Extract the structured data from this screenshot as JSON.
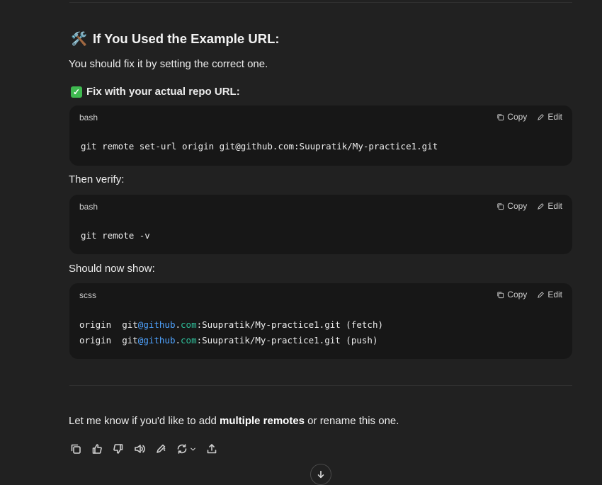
{
  "section": {
    "heading_icon": "🛠️",
    "heading": "If You Used the Example URL:",
    "intro": "You should fix it by setting the correct one.",
    "fix_label": "Fix with your actual repo URL:"
  },
  "blocks": [
    {
      "lang": "bash",
      "lines": [
        "git remote set-url origin git@github.com:Suupratik/My-practice1.git"
      ]
    },
    {
      "lang": "bash",
      "lines": [
        "git remote -v"
      ]
    },
    {
      "lang": "scss"
    }
  ],
  "scss_lines": [
    {
      "a": "origin  git",
      "b": "@github",
      "c": ".",
      "d": "com",
      "e": ":Suupratik/My-practice1.git (fetch)"
    },
    {
      "a": "origin  git",
      "b": "@github",
      "c": ".",
      "d": "com",
      "e": ":Suupratik/My-practice1.git (push)"
    }
  ],
  "verify_label": "Then verify:",
  "show_label": "Should now show:",
  "tools": {
    "copy": "Copy",
    "edit": "Edit"
  },
  "closing": {
    "before": "Let me know if you'd like to add ",
    "bold": "multiple remotes",
    "after": " or rename this one."
  },
  "colors": {
    "background": "#212121",
    "code_bg": "#171717",
    "token_blue": "#4fa3ff",
    "token_green": "#2fbf9a",
    "check_green": "#3fb950"
  },
  "icons": [
    "copy-icon",
    "thumbs-up-icon",
    "thumbs-down-icon",
    "speaker-icon",
    "edit-pen-icon",
    "regenerate-icon",
    "chevron-down-icon",
    "share-icon",
    "arrow-down-icon"
  ]
}
